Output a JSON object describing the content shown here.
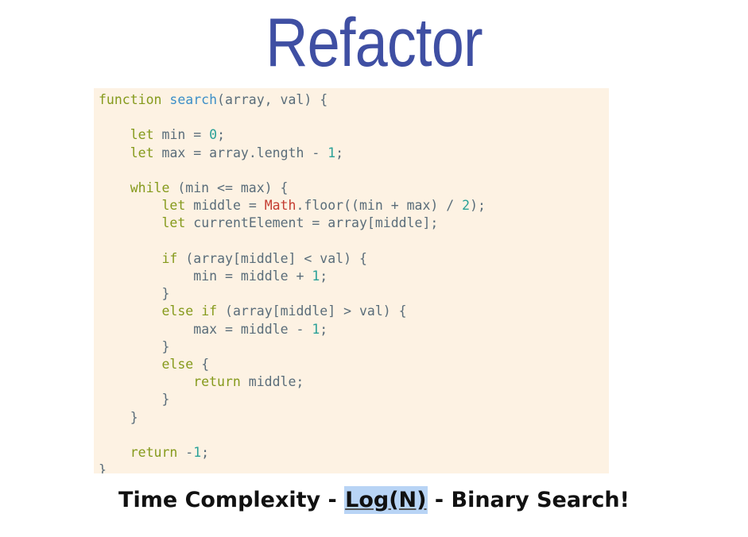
{
  "slide": {
    "title": "Refactor",
    "caption_prefix": "Time Complexity - ",
    "caption_highlight": "Log(N)",
    "caption_suffix": " - Binary Search!"
  },
  "code_lines": [
    "function search(array, val) {",
    "",
    "    let min = 0;",
    "    let max = array.length - 1;",
    "",
    "    while (min <= max) {",
    "        let middle = Math.floor((min + max) / 2);",
    "        let currentElement = array[middle];",
    "",
    "        if (array[middle] < val) {",
    "            min = middle + 1;",
    "        }",
    "        else if (array[middle] > val) {",
    "            max = middle - 1;",
    "        }",
    "        else {",
    "            return middle;",
    "        }",
    "    }",
    "",
    "    return -1;",
    "}"
  ],
  "colors": {
    "title": "#3f4fa3",
    "code_background": "#fdf2e3",
    "keyword": "#859a1c",
    "function_name": "#3d8fc8",
    "number": "#2aa198",
    "builtin": "#c43b30",
    "highlight": "#b8d4f5"
  }
}
